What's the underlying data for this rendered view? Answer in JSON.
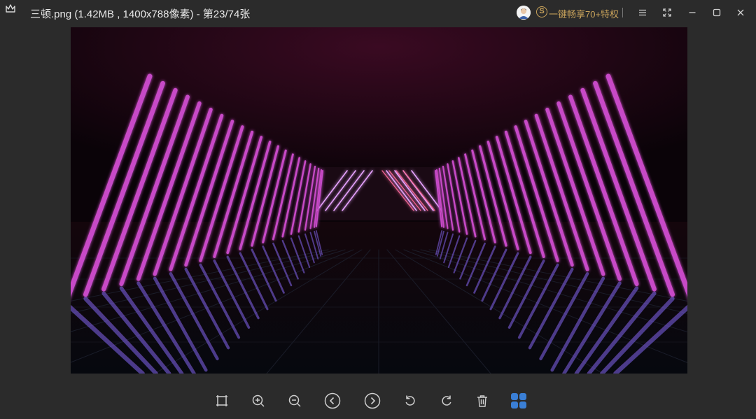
{
  "window": {
    "title": "三顿.png (1.42MB , 1400x788像素) - 第23/74张",
    "vip_badge": "S",
    "vip_promo": "一键畅享70+特权"
  },
  "icons": {
    "app_logo": "crown-icon",
    "avatar": "user-avatar",
    "menu": "menu-icon",
    "fullscreen": "fullscreen-icon",
    "minimize": "minimize-icon",
    "maximize": "maximize-icon",
    "close": "close-icon"
  },
  "image": {
    "alt": "Neon tunnel with pink and blue light tubes"
  },
  "toolbar": {
    "items": [
      "fit-to-window",
      "zoom-in",
      "zoom-out",
      "previous",
      "next",
      "rotate-left",
      "rotate-right",
      "delete",
      "thumbnails"
    ]
  },
  "colors": {
    "background": "#2b2b2b",
    "accent_gold": "#c9a35b",
    "thumbnail_blue": "#3a7fd6",
    "neon_pink": "#ff2a6d",
    "neon_blue": "#5aa0ff"
  }
}
